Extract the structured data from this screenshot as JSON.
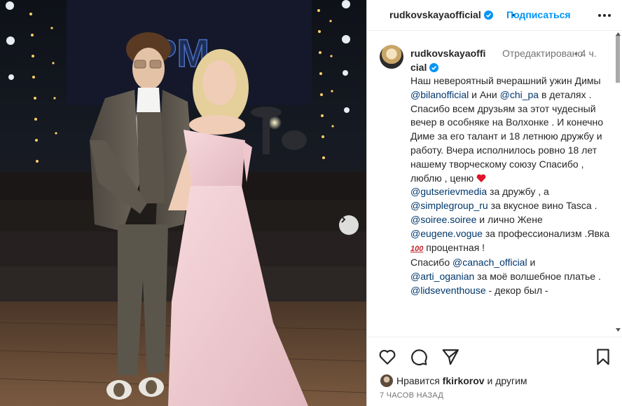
{
  "post_header": {
    "username": "rudkovskayaofficial",
    "separator": "•",
    "follow_label": "Подписаться"
  },
  "caption": {
    "username": "rudkovskayaofficial",
    "meta": "Отредактировано",
    "meta_separator": "•",
    "time": "4 ч.",
    "segments": {
      "t1": "Наш невероятный вчерашний ужин Димы ",
      "m1": "@bilanofficial",
      "t2": " и Ани ",
      "m2": "@chi_pa",
      "t3": " в деталях . Спасибо всем друзьям за этот чудесный вечер в особняке на Волхонке . И конечно Диме за его талант и 18 летнюю дружбу и работу. Вчера исполнилось ровно 18 лет нашему творческому союзу Спасибо , люблю , ценю ",
      "m3": "@gutserievmedia",
      "t4": " за дружбу , а ",
      "m4": "@simplegroup_ru",
      "t5": " за вкусное вино Tasca .",
      "m5": "@soiree.soiree",
      "t6": " и лично Жене ",
      "m6": "@eugene.vogue",
      "t7": " за профессионализм .Явка ",
      "e2": "100",
      "t8": " процентная !",
      "t9": "Спасибо ",
      "m7": "@canach_official",
      "t10": " и",
      "m8": "@arti_oganian",
      "t11": " за моё волшебное платье .",
      "m9": "@lidseventhouse",
      "t12": " - декор был -"
    }
  },
  "actions": {
    "like_icon": "heart-outline-icon",
    "comment_icon": "comment-icon",
    "share_icon": "paper-plane-icon",
    "save_icon": "bookmark-icon"
  },
  "likes": {
    "prefix": "Нравится ",
    "liker": "fkirkorov",
    "suffix": " и другим"
  },
  "timestamp": "7 ЧАСОВ НАЗАД",
  "colors": {
    "link": "#0095f6",
    "mention": "#00376b",
    "secondary_text": "#737373",
    "border": "#dbdbdb"
  }
}
